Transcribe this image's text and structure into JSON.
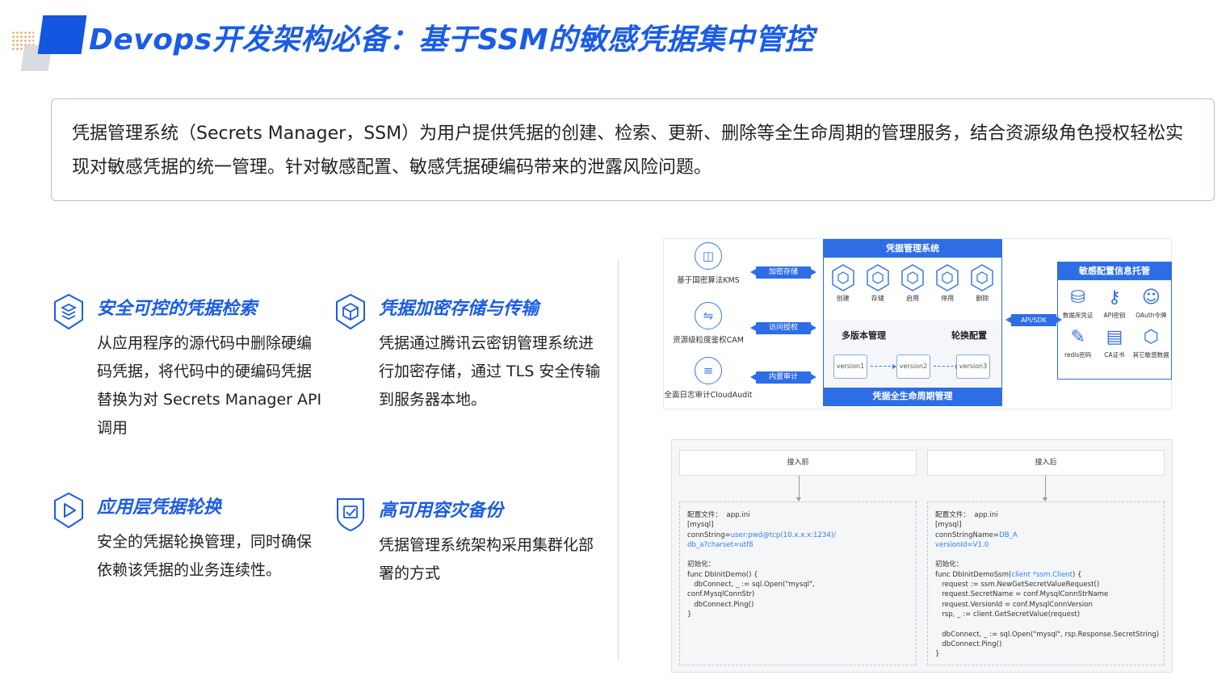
{
  "header": {
    "title": "Devops开发架构必备：基于SSM的敏感凭据集中管控"
  },
  "intro": {
    "text": "凭据管理系统（Secrets Manager，SSM）为用户提供凭据的创建、检索、更新、删除等全生命周期的管理服务，结合资源级角色授权轻松实现对敏感凭据的统一管理。针对敏感配置、敏感凭据硬编码带来的泄露风险问题。"
  },
  "features": [
    {
      "icon": "layers-shield-icon",
      "title": "安全可控的凭据检索",
      "text": "从应用程序的源代码中删除硬编码凭据，将代码中的硬编码凭据替换为对 Secrets Manager API 调用"
    },
    {
      "icon": "cube-shield-icon",
      "title": "凭据加密存储与传输",
      "text": "凭据通过腾讯云密钥管理系统进行加密存储，通过 TLS 安全传输到服务器本地。"
    },
    {
      "icon": "play-shield-icon",
      "title": "应用层凭据轮换",
      "text": "安全的凭据轮换管理，同时确保依赖该凭据的业务连续性。"
    },
    {
      "icon": "check-shield-icon",
      "title": "高可用容灾备份",
      "text": "凭据管理系统架构采用集群化部署的方式"
    }
  ],
  "architecture": {
    "services": [
      {
        "label": "基于国密算法KMS",
        "arrow": "加密存储",
        "icon": "lock-icon"
      },
      {
        "label": "资源级粒度鉴权CAM",
        "arrow": "访问授权",
        "icon": "refresh-icon"
      },
      {
        "label": "全面日志审计CloudAudit",
        "arrow": "内置审计",
        "icon": "log-icon"
      }
    ],
    "ssm_title": "凭据管理系统",
    "ssm_ops": [
      "创建",
      "存储",
      "启用",
      "停用",
      "删除"
    ],
    "multi_version": "多版本管理",
    "rotation": "轮换配置",
    "versions": [
      "version1",
      "version2",
      "version3"
    ],
    "lifecycle": "凭据全生命周期管理",
    "api_label": "API/SDK",
    "sensitive_title": "敏感配置信息托管",
    "sensitive_items": [
      {
        "label": "数据库凭证",
        "icon": "database-icon"
      },
      {
        "label": "API密钥",
        "icon": "key-icon"
      },
      {
        "label": "OAuth令牌",
        "icon": "users-icon"
      },
      {
        "label": "redis密码",
        "icon": "pencil-icon"
      },
      {
        "label": "CA证书",
        "icon": "certificate-icon"
      },
      {
        "label": "其它敏感数据...",
        "icon": "cube-icon"
      }
    ]
  },
  "code_compare": {
    "before_label": "接入前",
    "after_label": "接入后",
    "before_lines": [
      [
        {
          "t": "配置文件：  app.ini"
        }
      ],
      [
        {
          "t": "[mysql]"
        }
      ],
      [
        {
          "t": "connString="
        },
        {
          "t": "user:pwd@tcp(10.x.x.x:1234)/",
          "hl": true
        }
      ],
      [
        {
          "t": "db_a?charset=utf8",
          "hl": true
        }
      ],
      [
        {
          "t": ""
        }
      ],
      [
        {
          "t": "初始化："
        }
      ],
      [
        {
          "t": "func DbInitDemo() {"
        }
      ],
      [
        {
          "t": "   dbConnect, _ := sql.Open(\"mysql\","
        }
      ],
      [
        {
          "t": "conf.MysqlConnStr)"
        }
      ],
      [
        {
          "t": "   dbConnect.Ping()"
        }
      ],
      [
        {
          "t": "}"
        }
      ]
    ],
    "after_lines": [
      [
        {
          "t": "配置文件：  app.ini"
        }
      ],
      [
        {
          "t": "[mysql]"
        }
      ],
      [
        {
          "t": "connStringName="
        },
        {
          "t": "DB_A",
          "hl": true
        }
      ],
      [
        {
          "t": "versionId=V1.0",
          "hl": true
        }
      ],
      [
        {
          "t": ""
        }
      ],
      [
        {
          "t": "初始化："
        }
      ],
      [
        {
          "t": "func DbInitDemoSsm("
        },
        {
          "t": "client *ssm.Client",
          "hl": true
        },
        {
          "t": ") {"
        }
      ],
      [
        {
          "t": "   request := ssm.NewGetSecretValueRequest()"
        }
      ],
      [
        {
          "t": "   request.SecretName = conf.MysqlConnStrName"
        }
      ],
      [
        {
          "t": "   request.VersionId = conf.MysqlConnVersion"
        }
      ],
      [
        {
          "t": "   rsp, _ := client.GetSecretValue(request)"
        }
      ],
      [
        {
          "t": ""
        }
      ],
      [
        {
          "t": "   dbConnect, _ := sql.Open(\"mysql\", rsp.Response.SecretString)"
        }
      ],
      [
        {
          "t": "   dbConnect.Ping()"
        }
      ],
      [
        {
          "t": "}"
        }
      ]
    ]
  },
  "colors": {
    "accent": "#1a5ce6",
    "diagram_blue": "#2d6ee6",
    "code_highlight": "#2f7ff0"
  }
}
